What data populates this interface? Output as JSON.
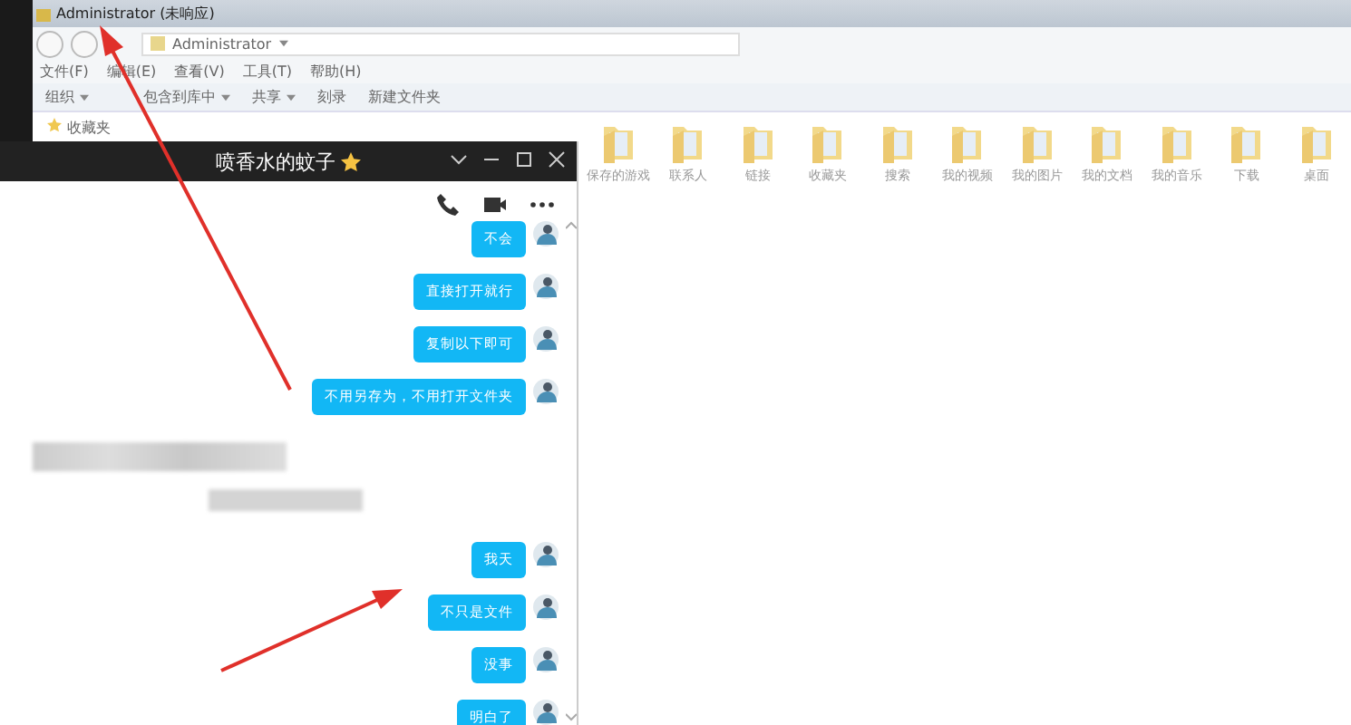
{
  "explorer": {
    "title": "Administrator (未响应)",
    "address": "Administrator",
    "menu": [
      "文件(F)",
      "编辑(E)",
      "查看(V)",
      "工具(T)",
      "帮助(H)"
    ],
    "toolbar": [
      {
        "label": "组织",
        "dropdown": true
      },
      {
        "label": "包含到库中",
        "dropdown": true
      },
      {
        "label": "共享",
        "dropdown": true
      },
      {
        "label": "刻录",
        "dropdown": false
      },
      {
        "label": "新建文件夹",
        "dropdown": false
      }
    ],
    "favorites": "收藏夹",
    "folders": [
      "保存的游戏",
      "联系人",
      "链接",
      "收藏夹",
      "搜索",
      "我的视频",
      "我的图片",
      "我的文档",
      "我的音乐",
      "下载",
      "桌面"
    ]
  },
  "chat": {
    "title": "喷香水的蚊子",
    "starred": true,
    "messages": [
      {
        "kind": "outgoing",
        "text": "不会"
      },
      {
        "kind": "outgoing",
        "text": "直接打开就行"
      },
      {
        "kind": "outgoing",
        "text": "复制以下即可"
      },
      {
        "kind": "outgoing",
        "text": "不用另存为，不用打开文件夹"
      },
      {
        "kind": "blurred"
      },
      {
        "kind": "outgoing",
        "text": "我天"
      },
      {
        "kind": "outgoing",
        "text": "不只是文件"
      },
      {
        "kind": "outgoing",
        "text": "没事"
      },
      {
        "kind": "outgoing",
        "text": "明白了"
      }
    ]
  }
}
